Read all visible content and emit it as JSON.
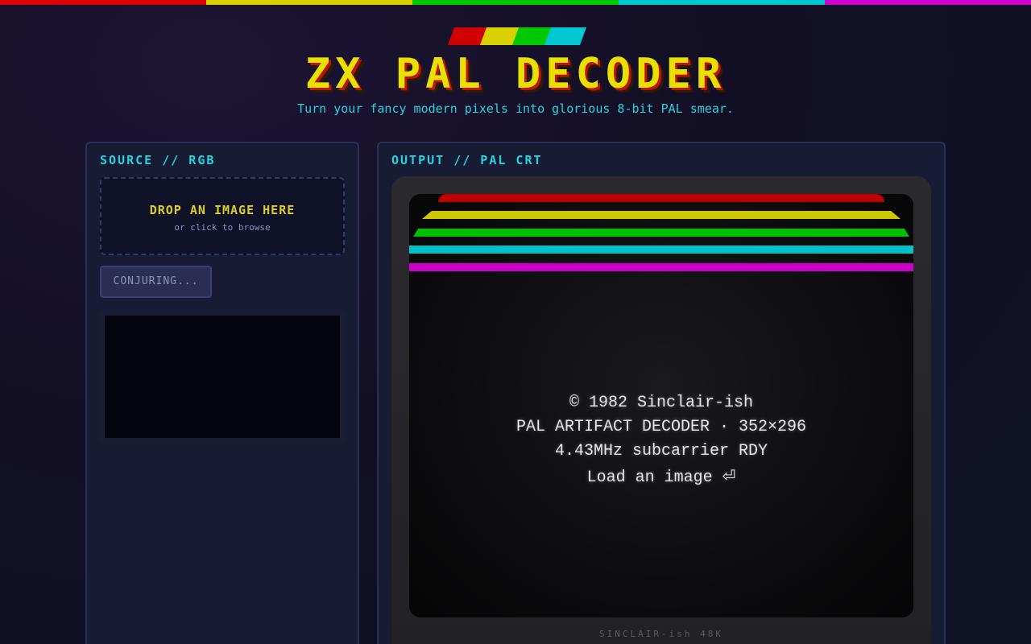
{
  "colors": {
    "stripe": [
      "#e00000",
      "#d8d000",
      "#00c800",
      "#00c8d0",
      "#d000d0"
    ],
    "logo_bars": [
      "#d00000",
      "#d8d000",
      "#00c800",
      "#00c8d0"
    ],
    "accent_cyan": "#26d4e0",
    "accent_yellow": "#e8e000"
  },
  "header": {
    "title": "ZX PAL DECODER",
    "subtitle": "Turn your fancy modern pixels into glorious 8-bit PAL smear."
  },
  "source_panel": {
    "title": "SOURCE // RGB",
    "dropzone_title": "DROP AN IMAGE HERE",
    "dropzone_sub": "or click to browse",
    "button_label": "CONJURING..."
  },
  "output_panel": {
    "title": "OUTPUT // PAL CRT",
    "screen_lines": [
      "© 1982 Sinclair-ish",
      "PAL ARTIFACT DECODER · 352×296",
      "4.43MHz subcarrier RDY",
      "Load an image ⏎"
    ],
    "crt_label": "SINCLAIR-ish 48K"
  }
}
